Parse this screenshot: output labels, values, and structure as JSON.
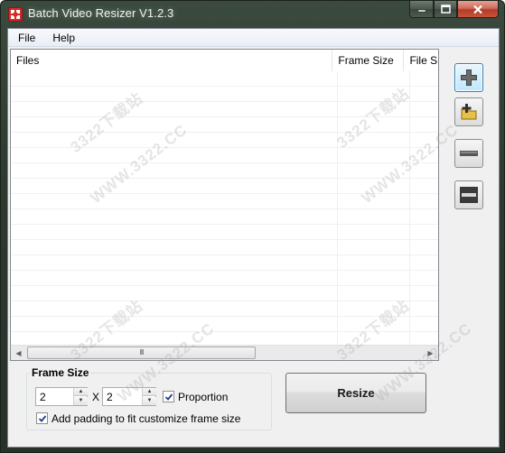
{
  "window": {
    "title": "Batch Video Resizer V1.2.3",
    "controls": {
      "minimize": "minimize",
      "maximize": "maximize",
      "close": "close"
    }
  },
  "menu": {
    "file": "File",
    "help": "Help"
  },
  "list": {
    "columns": [
      "Files",
      "Frame Size",
      "File S"
    ],
    "scroll_thumb": "III"
  },
  "side_buttons": {
    "add_file": "add-file-icon",
    "add_folder": "add-folder-icon",
    "remove": "remove-icon",
    "clear": "clear-list-icon"
  },
  "frame_size": {
    "group_label": "Frame Size",
    "width_value": "2",
    "height_value": "2",
    "separator": "X",
    "proportion_label": "Proportion",
    "proportion_checked": true,
    "padding_label": "Add padding to fit customize frame size",
    "padding_checked": true
  },
  "resize_button": "Resize",
  "watermark": {
    "line1": "3322下载站",
    "line2": "WWW.3322.CC"
  },
  "colors": {
    "accent": "#3c7fb1",
    "close": "#c9543c",
    "title_bg": "#2e3a31"
  }
}
